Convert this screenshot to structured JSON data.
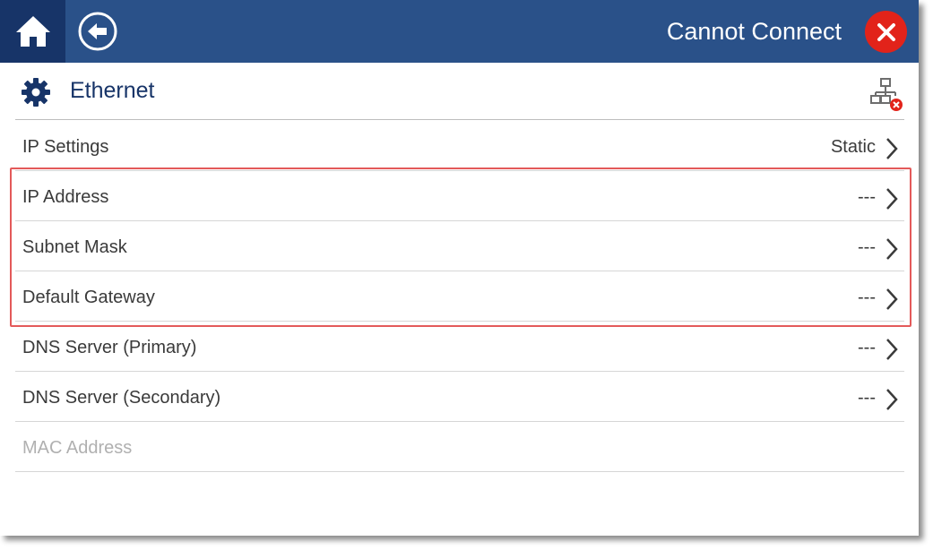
{
  "topbar": {
    "home_icon": "home-icon",
    "back_icon": "back-arrow-icon",
    "status_text": "Cannot Connect",
    "error_icon": "close-icon",
    "colors": {
      "bar": "#2a5189",
      "home_bg": "#173468",
      "error": "#e2231a"
    }
  },
  "section": {
    "icon": "gear-icon",
    "title": "Ethernet",
    "status_icon": "network-disconnected-icon"
  },
  "rows": [
    {
      "label": "IP Settings",
      "value": "Static",
      "enabled": true
    },
    {
      "label": "IP Address",
      "value": "---",
      "enabled": true
    },
    {
      "label": "Subnet Mask",
      "value": "---",
      "enabled": true
    },
    {
      "label": "Default Gateway",
      "value": "---",
      "enabled": true
    },
    {
      "label": "DNS Server (Primary)",
      "value": "---",
      "enabled": true
    },
    {
      "label": "DNS Server (Secondary)",
      "value": "---",
      "enabled": true
    },
    {
      "label": "MAC Address",
      "value": "",
      "enabled": false
    }
  ],
  "highlight_color": "#e35a5a"
}
